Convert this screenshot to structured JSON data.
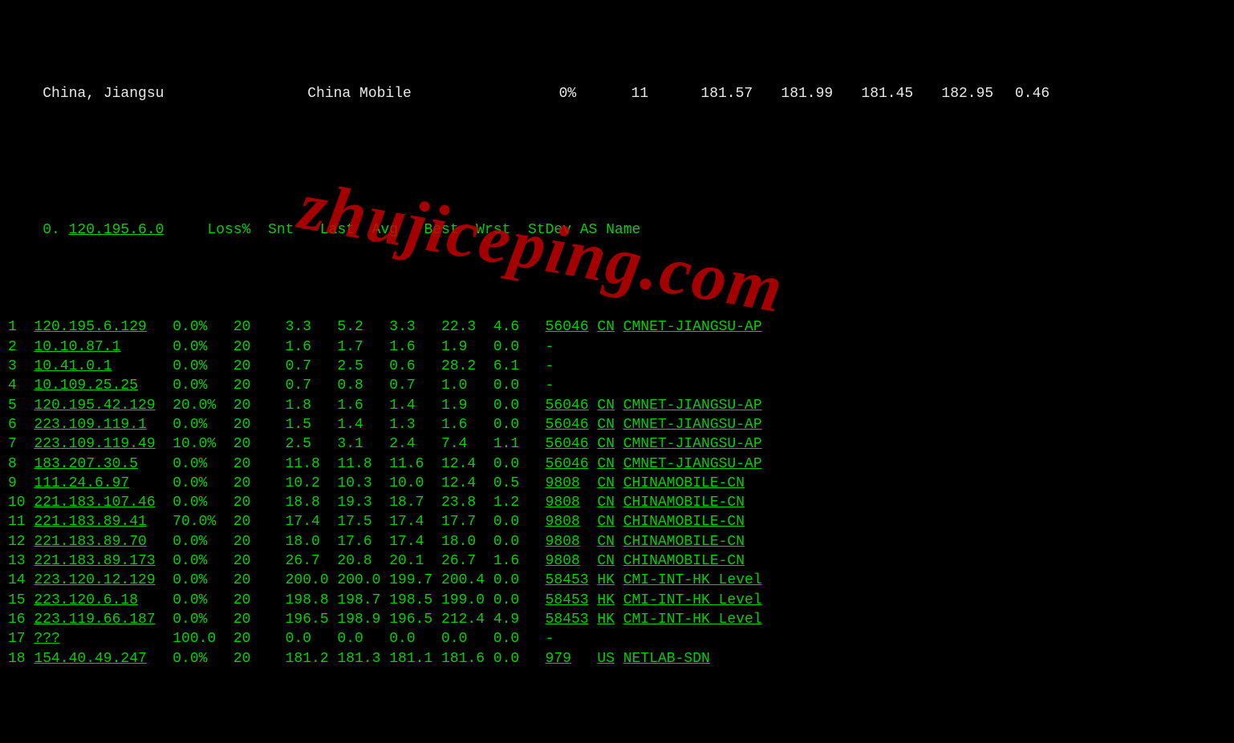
{
  "watermark": "zhujiceping.com",
  "top": {
    "location": "China, Jiangsu",
    "isp": "China Mobile",
    "loss": "0%",
    "probes": "11",
    "v1": "181.57",
    "v2": "181.99",
    "v3": "181.45",
    "v4": "182.95",
    "v5": "0.46"
  },
  "headers": {
    "hop0": "0.",
    "ip0": "120.195.6.0",
    "loss": "Loss%",
    "snt": "Snt",
    "last": "Last",
    "avg": "Avg",
    "best": "Best",
    "wrst": "Wrst",
    "stdev": "StDev",
    "asname": "AS Name"
  },
  "rows": [
    {
      "hop": "1",
      "ip": "120.195.6.129",
      "loss": "0.0%",
      "snt": "20",
      "last": "3.3",
      "avg": "5.2",
      "best": "3.3",
      "wrst": "22.3",
      "stdev": "4.6",
      "asn": "56046",
      "cc": "CN",
      "asname": "CMNET-JIANGSU-AP"
    },
    {
      "hop": "2",
      "ip": "10.10.87.1",
      "loss": "0.0%",
      "snt": "20",
      "last": "1.6",
      "avg": "1.7",
      "best": "1.6",
      "wrst": "1.9",
      "stdev": "0.0",
      "asn": "",
      "cc": "",
      "asname": "-"
    },
    {
      "hop": "3",
      "ip": "10.41.0.1",
      "loss": "0.0%",
      "snt": "20",
      "last": "0.7",
      "avg": "2.5",
      "best": "0.6",
      "wrst": "28.2",
      "stdev": "6.1",
      "asn": "",
      "cc": "",
      "asname": "-"
    },
    {
      "hop": "4",
      "ip": "10.109.25.25",
      "loss": "0.0%",
      "snt": "20",
      "last": "0.7",
      "avg": "0.8",
      "best": "0.7",
      "wrst": "1.0",
      "stdev": "0.0",
      "asn": "",
      "cc": "",
      "asname": "-"
    },
    {
      "hop": "5",
      "ip": "120.195.42.129",
      "loss": "20.0%",
      "snt": "20",
      "last": "1.8",
      "avg": "1.6",
      "best": "1.4",
      "wrst": "1.9",
      "stdev": "0.0",
      "asn": "56046",
      "cc": "CN",
      "asname": "CMNET-JIANGSU-AP"
    },
    {
      "hop": "6",
      "ip": "223.109.119.1",
      "loss": "0.0%",
      "snt": "20",
      "last": "1.5",
      "avg": "1.4",
      "best": "1.3",
      "wrst": "1.6",
      "stdev": "0.0",
      "asn": "56046",
      "cc": "CN",
      "asname": "CMNET-JIANGSU-AP"
    },
    {
      "hop": "7",
      "ip": "223.109.119.49",
      "loss": "10.0%",
      "snt": "20",
      "last": "2.5",
      "avg": "3.1",
      "best": "2.4",
      "wrst": "7.4",
      "stdev": "1.1",
      "asn": "56046",
      "cc": "CN",
      "asname": "CMNET-JIANGSU-AP"
    },
    {
      "hop": "8",
      "ip": "183.207.30.5",
      "loss": "0.0%",
      "snt": "20",
      "last": "11.8",
      "avg": "11.8",
      "best": "11.6",
      "wrst": "12.4",
      "stdev": "0.0",
      "asn": "56046",
      "cc": "CN",
      "asname": "CMNET-JIANGSU-AP"
    },
    {
      "hop": "9",
      "ip": "111.24.6.97",
      "loss": "0.0%",
      "snt": "20",
      "last": "10.2",
      "avg": "10.3",
      "best": "10.0",
      "wrst": "12.4",
      "stdev": "0.5",
      "asn": "9808",
      "cc": "CN",
      "asname": "CHINAMOBILE-CN"
    },
    {
      "hop": "10",
      "ip": "221.183.107.46",
      "loss": "0.0%",
      "snt": "20",
      "last": "18.8",
      "avg": "19.3",
      "best": "18.7",
      "wrst": "23.8",
      "stdev": "1.2",
      "asn": "9808",
      "cc": "CN",
      "asname": "CHINAMOBILE-CN"
    },
    {
      "hop": "11",
      "ip": "221.183.89.41",
      "loss": "70.0%",
      "snt": "20",
      "last": "17.4",
      "avg": "17.5",
      "best": "17.4",
      "wrst": "17.7",
      "stdev": "0.0",
      "asn": "9808",
      "cc": "CN",
      "asname": "CHINAMOBILE-CN"
    },
    {
      "hop": "12",
      "ip": "221.183.89.70",
      "loss": "0.0%",
      "snt": "20",
      "last": "18.0",
      "avg": "17.6",
      "best": "17.4",
      "wrst": "18.0",
      "stdev": "0.0",
      "asn": "9808",
      "cc": "CN",
      "asname": "CHINAMOBILE-CN"
    },
    {
      "hop": "13",
      "ip": "221.183.89.173",
      "loss": "0.0%",
      "snt": "20",
      "last": "26.7",
      "avg": "20.8",
      "best": "20.1",
      "wrst": "26.7",
      "stdev": "1.6",
      "asn": "9808",
      "cc": "CN",
      "asname": "CHINAMOBILE-CN"
    },
    {
      "hop": "14",
      "ip": "223.120.12.129",
      "loss": "0.0%",
      "snt": "20",
      "last": "200.0",
      "avg": "200.0",
      "best": "199.7",
      "wrst": "200.4",
      "stdev": "0.0",
      "asn": "58453",
      "cc": "HK",
      "asname": "CMI-INT-HK Level"
    },
    {
      "hop": "15",
      "ip": "223.120.6.18",
      "loss": "0.0%",
      "snt": "20",
      "last": "198.8",
      "avg": "198.7",
      "best": "198.5",
      "wrst": "199.0",
      "stdev": "0.0",
      "asn": "58453",
      "cc": "HK",
      "asname": "CMI-INT-HK Level"
    },
    {
      "hop": "16",
      "ip": "223.119.66.187",
      "loss": "0.0%",
      "snt": "20",
      "last": "196.5",
      "avg": "198.9",
      "best": "196.5",
      "wrst": "212.4",
      "stdev": "4.9",
      "asn": "58453",
      "cc": "HK",
      "asname": "CMI-INT-HK Level"
    },
    {
      "hop": "17",
      "ip": "???",
      "loss": "100.0",
      "snt": "20",
      "last": "0.0",
      "avg": "0.0",
      "best": "0.0",
      "wrst": "0.0",
      "stdev": "0.0",
      "asn": "",
      "cc": "",
      "asname": "-"
    },
    {
      "hop": "18",
      "ip": "154.40.49.247",
      "loss": "0.0%",
      "snt": "20",
      "last": "181.2",
      "avg": "181.3",
      "best": "181.1",
      "wrst": "181.6",
      "stdev": "0.0",
      "asn": "979",
      "cc": "US",
      "asname": "NETLAB-SDN"
    }
  ]
}
